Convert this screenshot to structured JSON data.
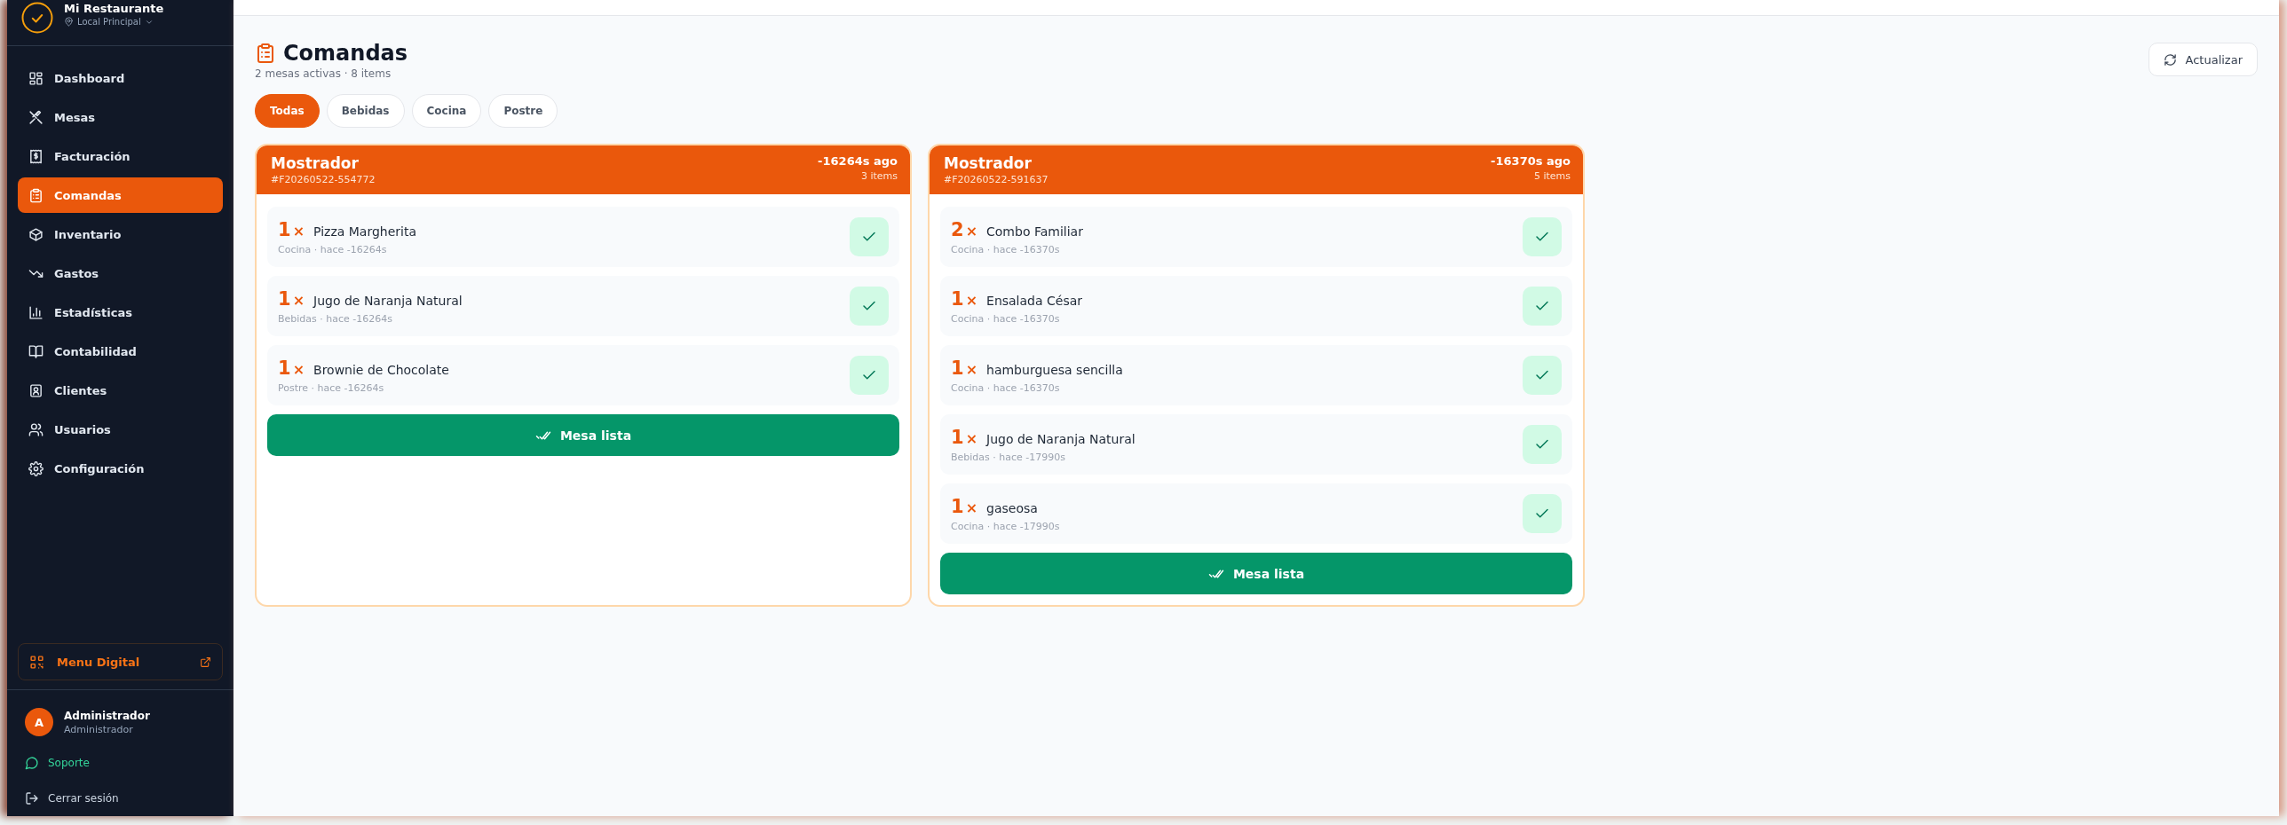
{
  "sidebar": {
    "brand": {
      "name": "Mi Restaurante",
      "location": "Local Principal"
    },
    "items": [
      {
        "label": "Dashboard",
        "selected": false
      },
      {
        "label": "Mesas",
        "selected": false
      },
      {
        "label": "Facturación",
        "selected": false
      },
      {
        "label": "Comandas",
        "selected": true
      },
      {
        "label": "Inventario",
        "selected": false
      },
      {
        "label": "Gastos",
        "selected": false
      },
      {
        "label": "Estadísticas",
        "selected": false
      },
      {
        "label": "Contabilidad",
        "selected": false
      },
      {
        "label": "Clientes",
        "selected": false
      },
      {
        "label": "Usuarios",
        "selected": false
      },
      {
        "label": "Configuración",
        "selected": false
      }
    ],
    "menu_digital": "Menu Digital",
    "user": {
      "initial": "A",
      "name": "Administrador",
      "role": "Administrador"
    },
    "support": "Soporte",
    "logout": "Cerrar sesión"
  },
  "page": {
    "title": "Comandas",
    "subtitle": "2 mesas activas · 8 items",
    "refresh": "Actualizar",
    "filters": [
      {
        "label": "Todas",
        "selected": true
      },
      {
        "label": "Bebidas",
        "selected": false
      },
      {
        "label": "Cocina",
        "selected": false
      },
      {
        "label": "Postre",
        "selected": false
      }
    ]
  },
  "orders": [
    {
      "table": "Mostrador",
      "code": "#F20260522-554772",
      "elapsed": "-16264s ago",
      "count": "3 items",
      "action": "Mesa lista",
      "items": [
        {
          "qty": "1",
          "mark": "×",
          "name": "Pizza Margherita",
          "meta": "Cocina · hace -16264s"
        },
        {
          "qty": "1",
          "mark": "×",
          "name": "Jugo de Naranja Natural",
          "meta": "Bebidas · hace -16264s"
        },
        {
          "qty": "1",
          "mark": "×",
          "name": "Brownie de Chocolate",
          "meta": "Postre · hace -16264s"
        }
      ]
    },
    {
      "table": "Mostrador",
      "code": "#F20260522-591637",
      "elapsed": "-16370s ago",
      "count": "5 items",
      "action": "Mesa lista",
      "items": [
        {
          "qty": "2",
          "mark": "×",
          "name": "Combo Familiar",
          "meta": "Cocina · hace -16370s"
        },
        {
          "qty": "1",
          "mark": "×",
          "name": "Ensalada César",
          "meta": "Cocina · hace -16370s"
        },
        {
          "qty": "1",
          "mark": "×",
          "name": "hamburguesa sencilla",
          "meta": "Cocina · hace -16370s"
        },
        {
          "qty": "1",
          "mark": "×",
          "name": "Jugo de Naranja Natural",
          "meta": "Bebidas · hace -17990s"
        },
        {
          "qty": "1",
          "mark": "×",
          "name": "gaseosa",
          "meta": "Cocina · hace -17990s"
        }
      ]
    }
  ]
}
